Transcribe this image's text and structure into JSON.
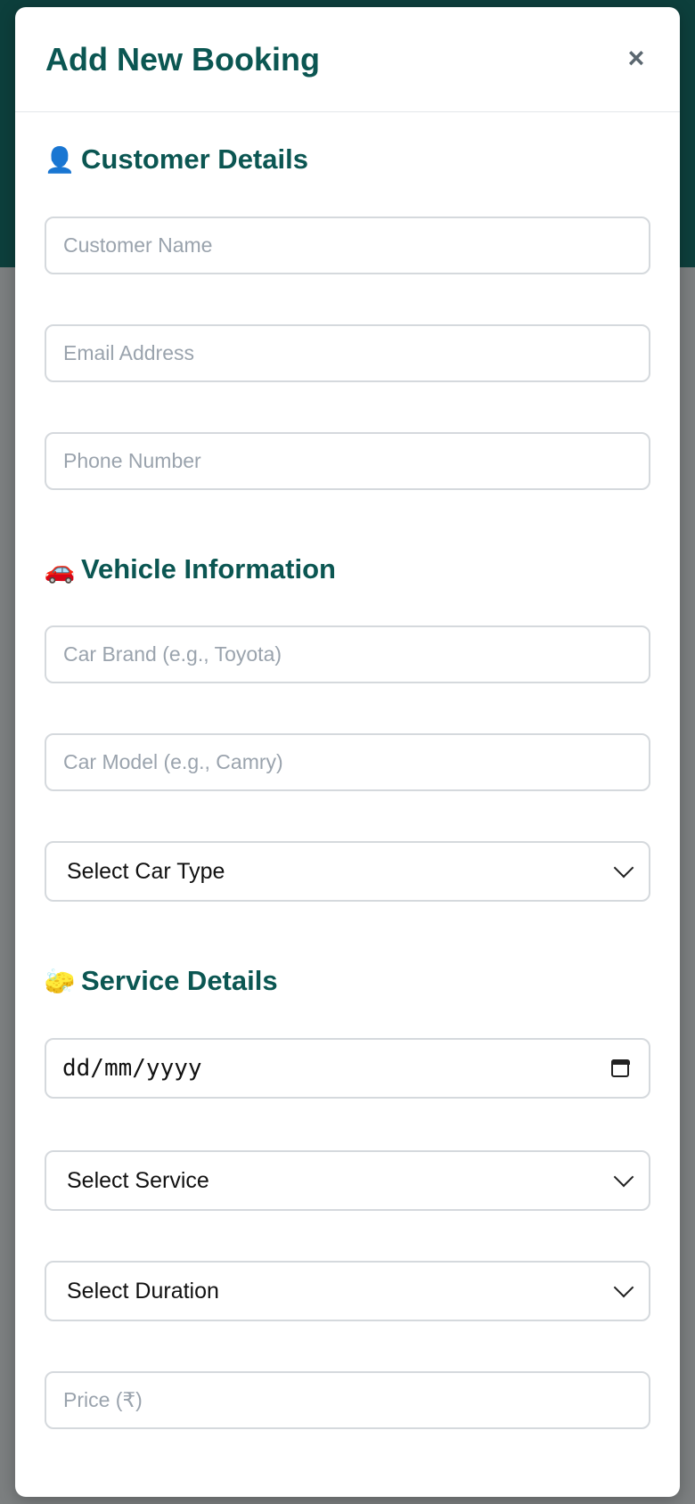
{
  "modal": {
    "title": "Add New Booking",
    "close_label": "×"
  },
  "sections": {
    "customer": {
      "icon": "👤",
      "title": "Customer Details",
      "fields": {
        "name_placeholder": "Customer Name",
        "email_placeholder": "Email Address",
        "phone_placeholder": "Phone Number"
      }
    },
    "vehicle": {
      "icon": "🚗",
      "title": "Vehicle Information",
      "fields": {
        "brand_placeholder": "Car Brand (e.g., Toyota)",
        "model_placeholder": "Car Model (e.g., Camry)",
        "car_type_selected": "Select Car Type"
      }
    },
    "service": {
      "icon": "🧽",
      "title": "Service Details",
      "fields": {
        "date_value": "dd/mm/yyyy",
        "service_selected": "Select Service",
        "duration_selected": "Select Duration",
        "price_placeholder": "Price (₹)"
      }
    }
  },
  "colors": {
    "accent": "#0b5652",
    "header_bg": "#0d3f3c",
    "overlay": "#7c7f80",
    "border": "#d5d9dd",
    "placeholder": "#9aa3ad"
  }
}
